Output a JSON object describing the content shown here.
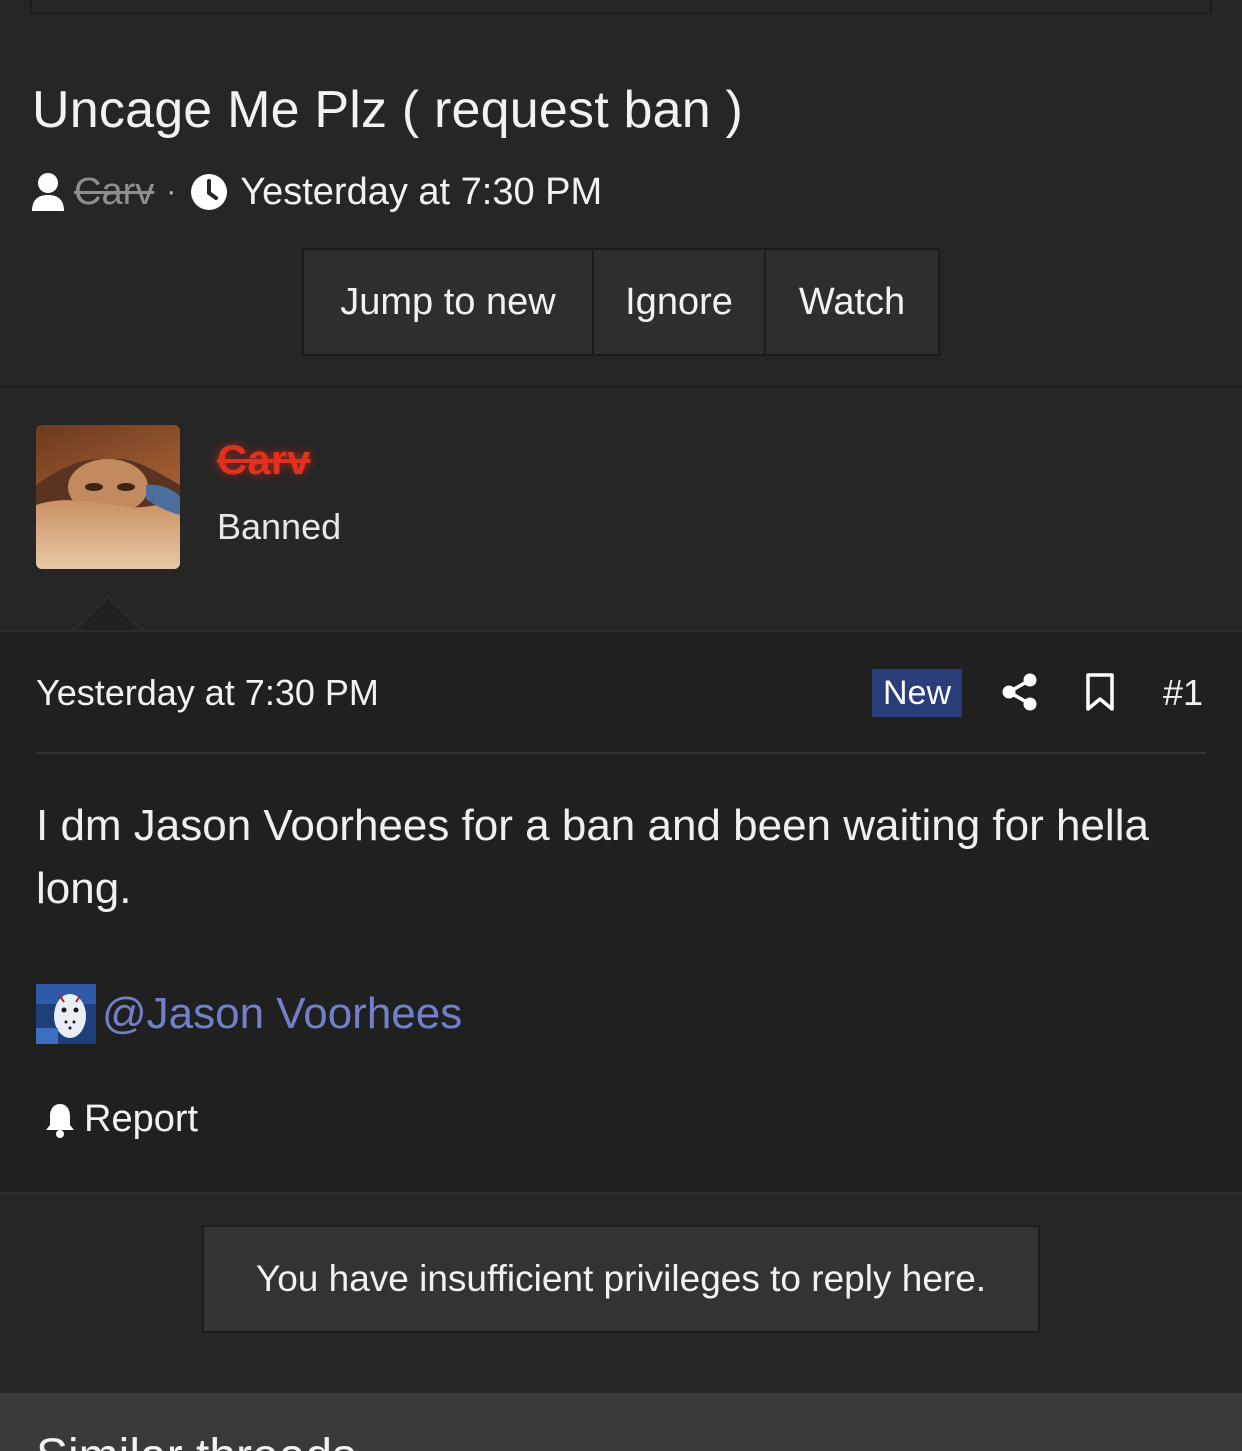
{
  "thread": {
    "title": "Uncage Me Plz ( request ban )",
    "author": "Carv",
    "separator": "·",
    "date": "Yesterday at 7:30 PM"
  },
  "actions": {
    "jump_to_new": "Jump to new",
    "ignore": "Ignore",
    "watch": "Watch"
  },
  "post": {
    "username": "Carv",
    "user_title": "Banned",
    "date": "Yesterday at 7:30 PM",
    "badge": "New",
    "number": "#1",
    "body": "I dm Jason Voorhees for a ban and been waiting for hella long.",
    "mention": "@Jason Voorhees",
    "report_label": "Report"
  },
  "notice": "You have insufficient privileges to reply here.",
  "footer": {
    "title": "Similar threads"
  },
  "colors": {
    "background": "#262626",
    "post_background": "#202020",
    "banned_name": "#e0301e",
    "link": "#7280c9",
    "new_badge": "#2a3c7a"
  },
  "icons": [
    "user-icon",
    "clock-icon",
    "share-icon",
    "bookmark-icon",
    "bell-icon"
  ]
}
